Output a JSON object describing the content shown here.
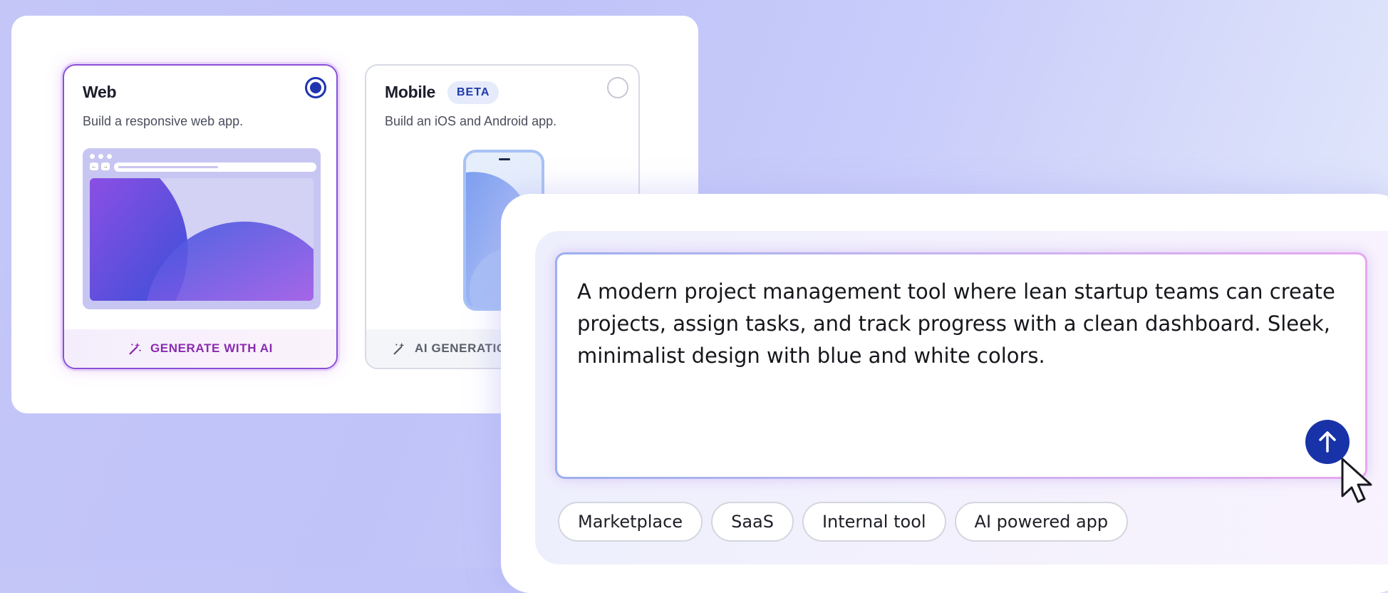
{
  "platforms": {
    "web": {
      "title": "Web",
      "description": "Build a responsive web app.",
      "footer_label": "GENERATE WITH AI",
      "selected": true
    },
    "mobile": {
      "title": "Mobile",
      "badge": "BETA",
      "description": "Build an iOS and Android app.",
      "footer_label": "AI GENERATIO",
      "selected": false
    }
  },
  "prompt": {
    "text": "A modern project management tool where lean startup teams can create projects, assign tasks, and track progress with a clean dashboard. Sleek, minimalist design with blue and white colors.",
    "send_icon": "arrow-up-icon"
  },
  "chips": [
    "Marketplace",
    "SaaS",
    "Internal tool",
    "AI powered app"
  ],
  "colors": {
    "accent_blue": "#1832a8",
    "accent_purple": "#8a2bb0",
    "badge_bg": "#e6ebfb"
  }
}
